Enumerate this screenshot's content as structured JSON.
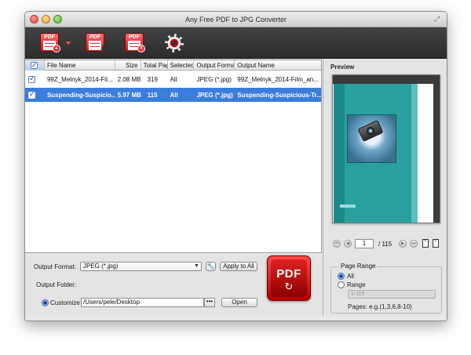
{
  "window": {
    "title": "Any Free PDF to JPG Converter"
  },
  "toolbar": {
    "add_icon": "pdf-add-icon",
    "edit_icon": "pdf-edit-icon",
    "remove_icon": "pdf-remove-icon",
    "settings_icon": "gear-icon",
    "pdf_text": "PDF"
  },
  "table": {
    "columns": [
      "File Name",
      "Size",
      "Total Pages",
      "Selected",
      "Output Format",
      "Output Name"
    ],
    "rows": [
      {
        "checked": true,
        "file_name": "99Z_Melnyk_2014-Fil...",
        "size": "2.08 MB",
        "total": "319",
        "selected": "All",
        "format": "JPEG (*.jpg)",
        "output_name": "99Z_Melnyk_2014-Film_an...",
        "highlighted": false
      },
      {
        "checked": true,
        "file_name": "Suspending-Suspicio...",
        "size": "5.97 MB",
        "total": "115",
        "selected": "All",
        "format": "JPEG (*.jpg)",
        "output_name": "Suspending-Suspicious-Tr...",
        "highlighted": true
      }
    ]
  },
  "output": {
    "format_label": "Output Format:",
    "format_value": "JPEG (*.jpg)",
    "apply_label": "Apply to All",
    "folder_label": "Output Folder:",
    "customize_label": "Customize",
    "path_value": "/Users/pele/Desktop",
    "ellipsis_label": "•••",
    "open_label": "Open"
  },
  "convert": {
    "text": "PDF",
    "arrows": "↻"
  },
  "preview": {
    "label": "Preview",
    "page_current": "1",
    "page_total": "/ 115"
  },
  "page_range": {
    "title": "Page Range",
    "all_label": "All",
    "range_label": "Range",
    "range_placeholder": "1-115",
    "hint": "Pages: e.g.(1,3,6,8-10)"
  },
  "colors": {
    "selection": "#3b7ddb",
    "accent_red": "#d60000"
  }
}
